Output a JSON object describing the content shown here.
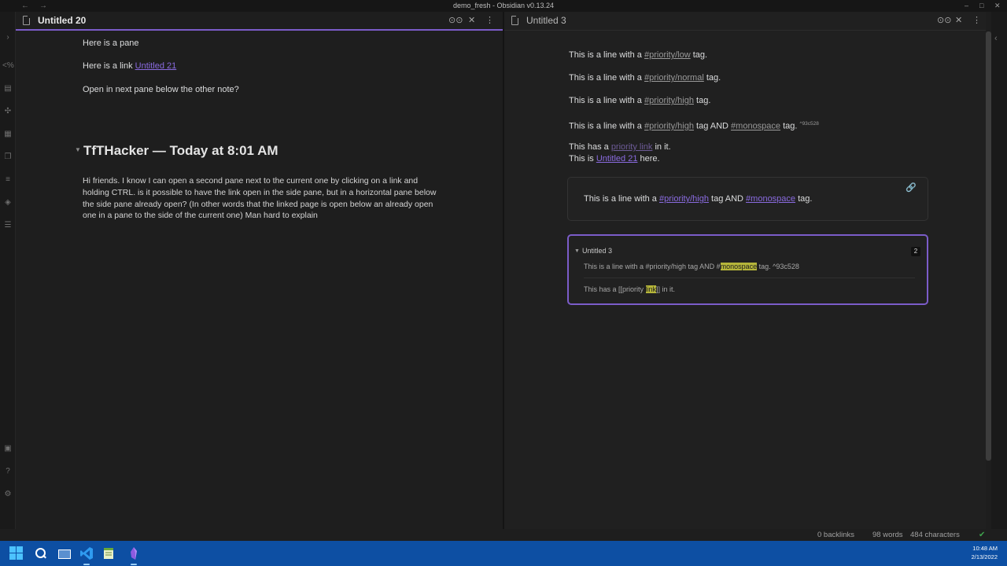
{
  "window": {
    "title": "demo_fresh - Obsidian v0.13.24",
    "back_glyph": "←",
    "forward_glyph": "→",
    "minimize_glyph": "–",
    "maximize_glyph": "□",
    "close_glyph": "✕"
  },
  "left_pane": {
    "title": "Untitled 20",
    "line1": "Here is a pane",
    "line2_prefix": "Here is a link ",
    "line2_link": "Untitled 21",
    "line3": "Open in next pane below the other note?",
    "heading": "TfTHacker — Today at 8:01 AM",
    "paragraph": "Hi friends. I know I can open a second pane next to the current one by clicking on a link and holding CTRL. is it possible to have the link open in the side pane, but in a horizontal pane below the side pane already open? (In other words that the linked page is open below an already open one in a pane to the side of the current one) Man hard to explain"
  },
  "right_pane": {
    "title": "Untitled 3",
    "lines": [
      {
        "prefix": "This is a line with a ",
        "tag": "#priority/low",
        "suffix": " tag."
      },
      {
        "prefix": "This is a line with a ",
        "tag": "#priority/normal",
        "suffix": " tag."
      },
      {
        "prefix": "This is a line with a ",
        "tag": "#priority/high",
        "suffix": " tag."
      }
    ],
    "line4": {
      "prefix": "This is a line with a ",
      "tag1": "#priority/high",
      "mid": " tag AND ",
      "tag2": "#monospace",
      "suffix": " tag. ",
      "block_id": "^93c528"
    },
    "line5": {
      "prefix": "This has a ",
      "link": "priority link",
      "suffix": " in it."
    },
    "line6": {
      "prefix": "This is ",
      "link": "Untitled 21",
      "suffix": " here."
    },
    "embed": {
      "prefix": "This is a line with a ",
      "tag1": "#priority/high",
      "mid": " tag AND ",
      "tag2": "#monospace",
      "suffix": " tag."
    },
    "backlinks": {
      "file": "Untitled 3",
      "count": "2",
      "result1": {
        "prefix": "This is a line with a #priority/high tag AND #",
        "highlight": "monospace",
        "suffix": " tag. ^93c528"
      },
      "result2": {
        "prefix": "This has a [[priority ",
        "highlight": "link",
        "suffix": "]] in it."
      }
    }
  },
  "status_bar": {
    "backlinks": "0 backlinks",
    "words": "98 words",
    "characters": "484 characters"
  },
  "taskbar": {
    "time": "10:48 AM",
    "date": "2/13/2022"
  },
  "colors": {
    "accent": "#7b5cc9",
    "link": "#8a6be0",
    "highlight": "#b5b53a",
    "taskbar": "#0d4fa3"
  }
}
